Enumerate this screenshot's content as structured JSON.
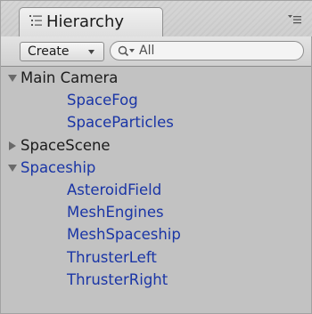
{
  "window": {
    "tab_title": "Hierarchy",
    "tab_icon": "hierarchy-list-icon",
    "menu_icon": "panel-menu-icon"
  },
  "toolbar": {
    "create_label": "Create",
    "create_icon": "dropdown-arrow-icon",
    "search_placeholder": "All",
    "search_icon": "search-filter-icon"
  },
  "tree": {
    "items": [
      {
        "label": "Main Camera",
        "depth": 0,
        "expanded": true,
        "has_children": true,
        "prefab": false
      },
      {
        "label": "SpaceFog",
        "depth": 1,
        "has_children": false,
        "prefab": true
      },
      {
        "label": "SpaceParticles",
        "depth": 1,
        "has_children": false,
        "prefab": true
      },
      {
        "label": "SpaceScene",
        "depth": 0,
        "expanded": false,
        "has_children": true,
        "prefab": false
      },
      {
        "label": "Spaceship",
        "depth": 0,
        "expanded": true,
        "has_children": true,
        "prefab": true
      },
      {
        "label": "AsteroidField",
        "depth": 1,
        "has_children": false,
        "prefab": true
      },
      {
        "label": "MeshEngines",
        "depth": 1,
        "has_children": false,
        "prefab": true
      },
      {
        "label": "MeshSpaceship",
        "depth": 1,
        "has_children": false,
        "prefab": true
      },
      {
        "label": "ThrusterLeft",
        "depth": 1,
        "has_children": false,
        "prefab": true
      },
      {
        "label": "ThrusterRight",
        "depth": 1,
        "has_children": false,
        "prefab": true
      }
    ]
  },
  "colors": {
    "prefab_text": "#1a35a6",
    "normal_text": "#1c1c1c",
    "panel_bg": "#c2c2c2"
  }
}
